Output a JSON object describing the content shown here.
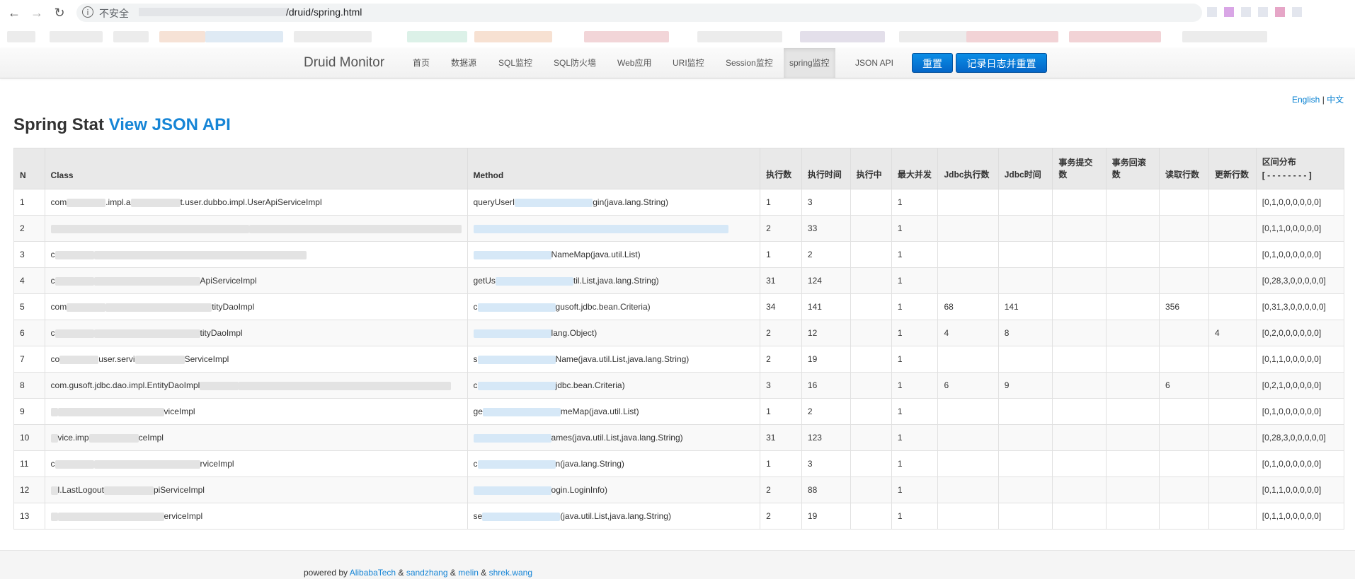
{
  "browser": {
    "back": "←",
    "forward": "→",
    "reload": "↻",
    "insecure_label": "不安全",
    "url_path": "/druid/spring.html"
  },
  "nav": {
    "brand": "Druid Monitor",
    "items": [
      "首页",
      "数据源",
      "SQL监控",
      "SQL防火墙",
      "Web应用",
      "URI监控",
      "Session监控",
      "spring监控",
      "JSON API"
    ],
    "active_index": 7,
    "reset_label": "重置",
    "log_reset_label": "记录日志并重置"
  },
  "lang": {
    "english": "English",
    "sep": "|",
    "chinese": "中文"
  },
  "title": {
    "text": "Spring Stat",
    "link": "View JSON API"
  },
  "table": {
    "headers": [
      "N",
      "Class",
      "Method",
      "执行数",
      "执行时间",
      "执行中",
      "最大并发",
      "Jdbc执行数",
      "Jdbc时间",
      "事务提交数",
      "事务回滚数",
      "读取行数",
      "更新行数"
    ],
    "range_header": "区间分布",
    "range_sub": "[ - - - - - - - - ]",
    "rows": [
      {
        "n": "1",
        "cls_a": "com",
        "cls_b": ".impl.a",
        "cls_c": "t.user.dubbo.impl.UserApiServiceImpl",
        "m_a": "queryUserI",
        "m_b": "gin(java.lang.String)",
        "exec": "1",
        "time": "3",
        "running": "",
        "concur": "1",
        "jdbc": "",
        "jdbct": "",
        "commit": "",
        "rollback": "",
        "read": "",
        "update": "",
        "range": "[0,1,0,0,0,0,0,0]"
      },
      {
        "n": "2",
        "cls_a": "",
        "cls_b": "",
        "cls_c": "",
        "m_a": "",
        "m_b": "",
        "exec": "2",
        "time": "33",
        "running": "",
        "concur": "1",
        "jdbc": "",
        "jdbct": "",
        "commit": "",
        "rollback": "",
        "read": "",
        "update": "",
        "range": "[0,1,1,0,0,0,0,0]"
      },
      {
        "n": "3",
        "cls_a": "c",
        "cls_b": "",
        "cls_c": "",
        "m_a": "",
        "m_b": "NameMap(java.util.List)",
        "exec": "1",
        "time": "2",
        "running": "",
        "concur": "1",
        "jdbc": "",
        "jdbct": "",
        "commit": "",
        "rollback": "",
        "read": "",
        "update": "",
        "range": "[0,1,0,0,0,0,0,0]"
      },
      {
        "n": "4",
        "cls_a": "c",
        "cls_b": "",
        "cls_c": "ApiServiceImpl",
        "m_a": "getUs",
        "m_b": "til.List,java.lang.String)",
        "exec": "31",
        "time": "124",
        "running": "",
        "concur": "1",
        "jdbc": "",
        "jdbct": "",
        "commit": "",
        "rollback": "",
        "read": "",
        "update": "",
        "range": "[0,28,3,0,0,0,0,0]"
      },
      {
        "n": "5",
        "cls_a": "com",
        "cls_b": "",
        "cls_c": "tityDaoImpl",
        "m_a": "c",
        "m_b": "gusoft.jdbc.bean.Criteria)",
        "exec": "34",
        "time": "141",
        "running": "",
        "concur": "1",
        "jdbc": "68",
        "jdbct": "141",
        "commit": "",
        "rollback": "",
        "read": "356",
        "update": "",
        "range": "[0,31,3,0,0,0,0,0]"
      },
      {
        "n": "6",
        "cls_a": "c",
        "cls_b": "",
        "cls_c": "tityDaoImpl",
        "m_a": "",
        "m_b": "lang.Object)",
        "exec": "2",
        "time": "12",
        "running": "",
        "concur": "1",
        "jdbc": "4",
        "jdbct": "8",
        "commit": "",
        "rollback": "",
        "read": "",
        "update": "4",
        "range": "[0,2,0,0,0,0,0,0]"
      },
      {
        "n": "7",
        "cls_a": "co",
        "cls_b": "user.servi",
        "cls_c": "ServiceImpl",
        "m_a": "s",
        "m_b": "Name(java.util.List,java.lang.String)",
        "exec": "2",
        "time": "19",
        "running": "",
        "concur": "1",
        "jdbc": "",
        "jdbct": "",
        "commit": "",
        "rollback": "",
        "read": "",
        "update": "",
        "range": "[0,1,1,0,0,0,0,0]"
      },
      {
        "n": "8",
        "cls_a": "com.gusoft.jdbc.dao.impl.EntityDaoImpl",
        "cls_b": "",
        "cls_c": "",
        "m_a": "c",
        "m_b": "jdbc.bean.Criteria)",
        "exec": "3",
        "time": "16",
        "running": "",
        "concur": "1",
        "jdbc": "6",
        "jdbct": "9",
        "commit": "",
        "rollback": "",
        "read": "6",
        "update": "",
        "range": "[0,2,1,0,0,0,0,0]"
      },
      {
        "n": "9",
        "cls_a": "",
        "cls_b": "",
        "cls_c": "viceImpl",
        "m_a": "ge",
        "m_b": "meMap(java.util.List)",
        "exec": "1",
        "time": "2",
        "running": "",
        "concur": "1",
        "jdbc": "",
        "jdbct": "",
        "commit": "",
        "rollback": "",
        "read": "",
        "update": "",
        "range": "[0,1,0,0,0,0,0,0]"
      },
      {
        "n": "10",
        "cls_a": "",
        "cls_b": "vice.imp",
        "cls_c": "ceImpl",
        "m_a": "",
        "m_b": "ames(java.util.List,java.lang.String)",
        "exec": "31",
        "time": "123",
        "running": "",
        "concur": "1",
        "jdbc": "",
        "jdbct": "",
        "commit": "",
        "rollback": "",
        "read": "",
        "update": "",
        "range": "[0,28,3,0,0,0,0,0]"
      },
      {
        "n": "11",
        "cls_a": "c",
        "cls_b": "",
        "cls_c": "rviceImpl",
        "m_a": "c",
        "m_b": "n(java.lang.String)",
        "exec": "1",
        "time": "3",
        "running": "",
        "concur": "1",
        "jdbc": "",
        "jdbct": "",
        "commit": "",
        "rollback": "",
        "read": "",
        "update": "",
        "range": "[0,1,0,0,0,0,0,0]"
      },
      {
        "n": "12",
        "cls_a": "",
        "cls_b": "l.LastLogout",
        "cls_c": "piServiceImpl",
        "m_a": "",
        "m_b": "ogin.LoginInfo)",
        "exec": "2",
        "time": "88",
        "running": "",
        "concur": "1",
        "jdbc": "",
        "jdbct": "",
        "commit": "",
        "rollback": "",
        "read": "",
        "update": "",
        "range": "[0,1,1,0,0,0,0,0]"
      },
      {
        "n": "13",
        "cls_a": "",
        "cls_b": "",
        "cls_c": "erviceImpl",
        "m_a": "se",
        "m_b": "(java.util.List,java.lang.String)",
        "exec": "2",
        "time": "19",
        "running": "",
        "concur": "1",
        "jdbc": "",
        "jdbct": "",
        "commit": "",
        "rollback": "",
        "read": "",
        "update": "",
        "range": "[0,1,1,0,0,0,0,0]"
      }
    ]
  },
  "footer": {
    "prefix": "powered by",
    "amp": "&",
    "link1": "AlibabaTech",
    "link2": "sandzhang",
    "link3": "melin",
    "link4": "shrek.wang"
  }
}
